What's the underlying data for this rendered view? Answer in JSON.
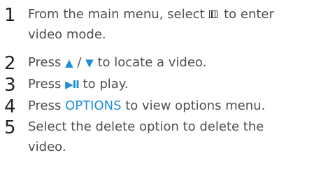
{
  "steps": [
    {
      "number": "1",
      "line1_before": "From the main menu, select ",
      "icon": "video-mode-icon",
      "line1_after": " to enter",
      "line2": "video mode."
    },
    {
      "number": "2",
      "before": "Press ",
      "up": "▲",
      "slash": " / ",
      "down": "▼",
      "after": " to locate a video."
    },
    {
      "number": "3",
      "before": "Press ",
      "play_pause": "▶II",
      "after": " to play."
    },
    {
      "number": "4",
      "before": "Press ",
      "key": "OPTIONS",
      "after": " to view options menu."
    },
    {
      "number": "5",
      "line1": "Select the delete option to delete the",
      "line2": "video."
    }
  ],
  "colors": {
    "accent": "#1d8fd6",
    "text": "#4f4f4f",
    "number": "#222222"
  }
}
